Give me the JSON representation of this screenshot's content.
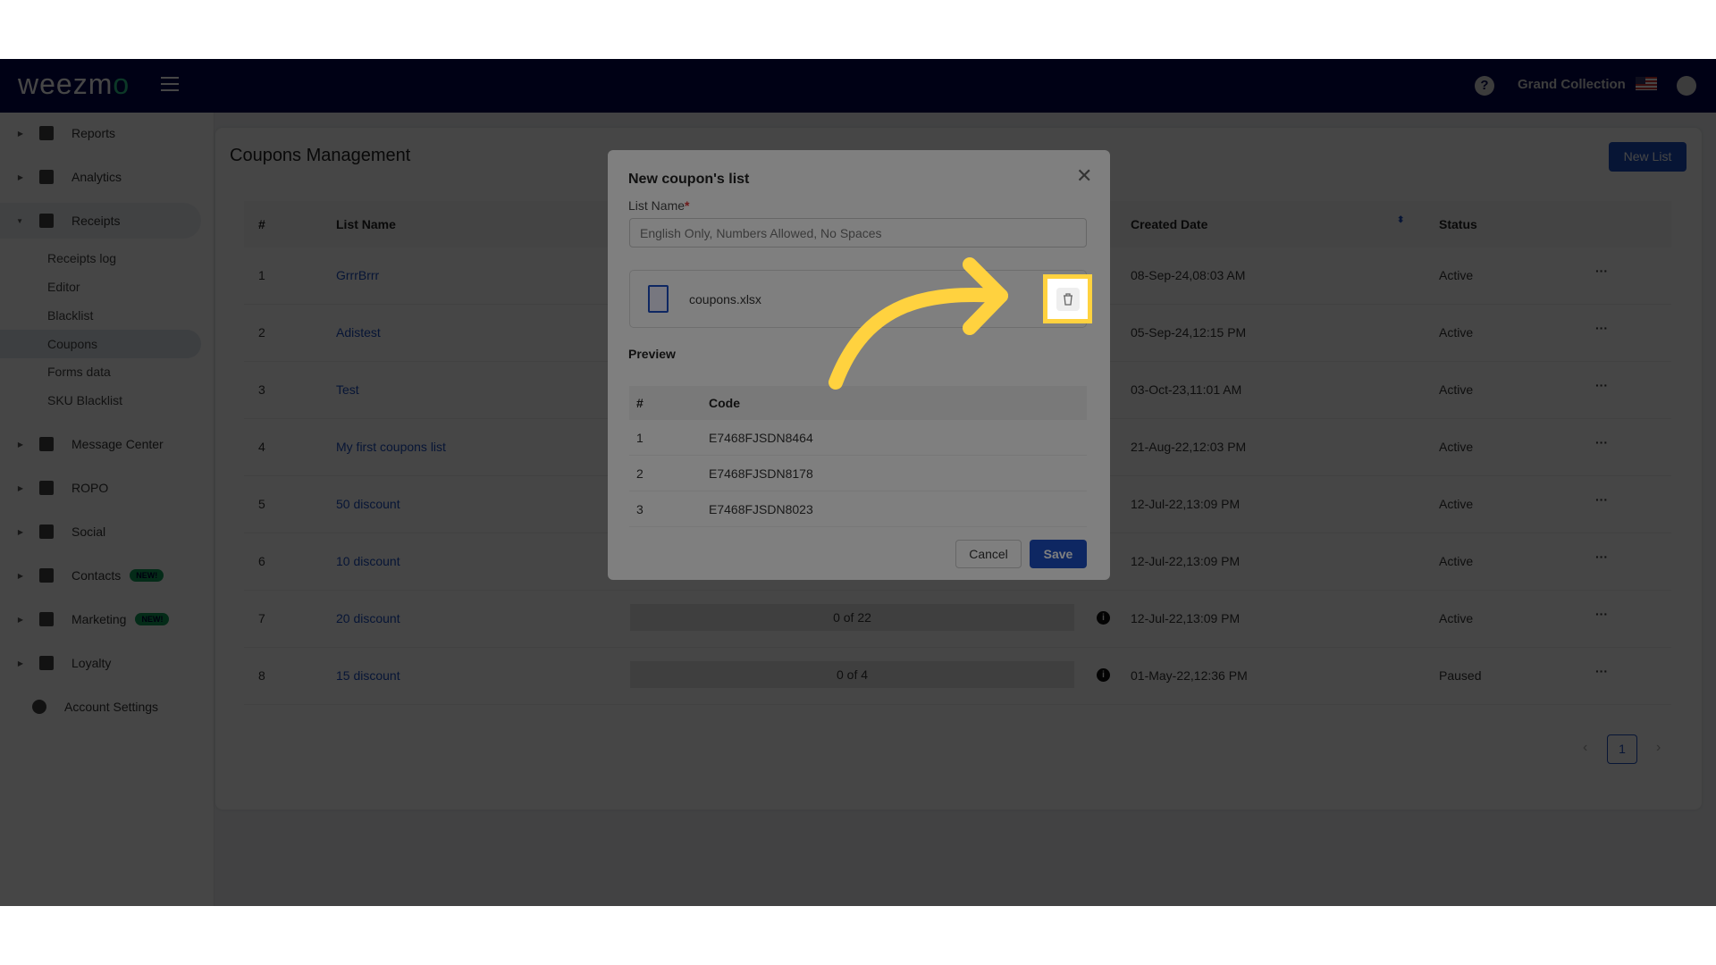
{
  "header": {
    "logo": "weezmo",
    "brand": "Grand Collection",
    "help_icon": "question-icon",
    "user_icon": "user-circle-icon"
  },
  "sidebar": {
    "items": [
      {
        "label": "Reports",
        "icon": "dashboard-icon"
      },
      {
        "label": "Analytics",
        "icon": "chart-icon"
      },
      {
        "label": "Receipts",
        "icon": "receipt-icon",
        "expanded": true,
        "children": [
          "Receipts log",
          "Editor",
          "Blacklist",
          "Coupons",
          "Forms data",
          "SKU Blacklist"
        ],
        "active_child": "Coupons"
      },
      {
        "label": "Message Center",
        "icon": "message-icon"
      },
      {
        "label": "ROPO",
        "icon": "infinity-icon"
      },
      {
        "label": "Social",
        "icon": "people-icon"
      },
      {
        "label": "Contacts",
        "icon": "contacts-icon",
        "badge": "NEW!"
      },
      {
        "label": "Marketing",
        "icon": "party-icon",
        "badge": "NEW!"
      },
      {
        "label": "Loyalty",
        "icon": "tag-icon"
      }
    ],
    "account_settings": "Account Settings"
  },
  "page": {
    "title": "Coupons Management",
    "new_list": "New List",
    "columns": [
      "#",
      "List Name",
      "Created Date",
      "Status"
    ],
    "rows": [
      {
        "n": "1",
        "name": "GrrrBrrr",
        "date": "08-Sep-24,08:03 AM",
        "status": "Active"
      },
      {
        "n": "2",
        "name": "Adistest",
        "date": "05-Sep-24,12:15 PM",
        "status": "Active"
      },
      {
        "n": "3",
        "name": "Test",
        "date": "03-Oct-23,11:01 AM",
        "status": "Active"
      },
      {
        "n": "4",
        "name": "My first coupons list",
        "date": "21-Aug-22,12:03 PM",
        "status": "Active"
      },
      {
        "n": "5",
        "name": "50 discount",
        "date": "12-Jul-22,13:09 PM",
        "status": "Active"
      },
      {
        "n": "6",
        "name": "10 discount",
        "date": "12-Jul-22,13:09 PM",
        "status": "Active"
      },
      {
        "n": "7",
        "name": "20 discount",
        "usage": "0 of 22",
        "date": "12-Jul-22,13:09 PM",
        "status": "Active"
      },
      {
        "n": "8",
        "name": "15 discount",
        "usage": "0 of 4",
        "date": "01-May-22,12:36 PM",
        "status": "Paused"
      }
    ],
    "page_number": "1"
  },
  "modal": {
    "title": "New coupon's list",
    "list_name_label": "List Name",
    "required": "*",
    "placeholder": "English Only, Numbers Allowed, No Spaces",
    "file_name": "coupons.xlsx",
    "preview": "Preview",
    "columns": [
      "#",
      "Code"
    ],
    "codes": [
      {
        "n": "1",
        "code": "E7468FJSDN8464"
      },
      {
        "n": "2",
        "code": "E7468FJSDN8178"
      },
      {
        "n": "3",
        "code": "E7468FJSDN8023"
      }
    ],
    "cancel": "Cancel",
    "save": "Save"
  },
  "tutorial": {
    "highlight_color": "#ffd23f",
    "target": "delete-file-button"
  }
}
